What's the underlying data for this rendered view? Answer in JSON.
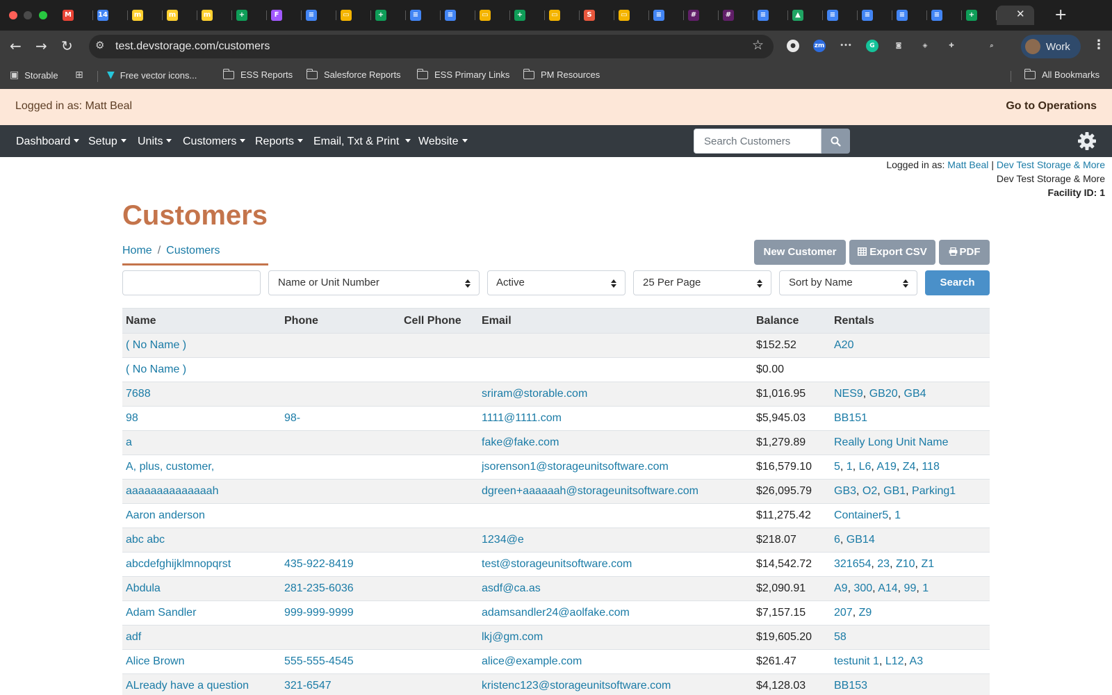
{
  "browser": {
    "tabs": [
      {
        "icon": "gmail-icon",
        "color": "#ea4335",
        "glyph": "M"
      },
      {
        "icon": "calendar-icon",
        "color": "#4285f4",
        "glyph": "14"
      },
      {
        "icon": "miro-icon",
        "color": "#ffd02f",
        "glyph": "m"
      },
      {
        "icon": "miro-icon",
        "color": "#ffd02f",
        "glyph": "m"
      },
      {
        "icon": "miro-icon",
        "color": "#ffd02f",
        "glyph": "m"
      },
      {
        "icon": "sheets-icon",
        "color": "#0f9d58",
        "glyph": "+"
      },
      {
        "icon": "figma-icon",
        "color": "#a259ff",
        "glyph": "F"
      },
      {
        "icon": "docs-icon",
        "color": "#4285f4",
        "glyph": "≡"
      },
      {
        "icon": "slides-icon",
        "color": "#f4b400",
        "glyph": "▭"
      },
      {
        "icon": "sheets-icon",
        "color": "#0f9d58",
        "glyph": "+"
      },
      {
        "icon": "docs-icon",
        "color": "#4285f4",
        "glyph": "≡"
      },
      {
        "icon": "docs-icon",
        "color": "#4285f4",
        "glyph": "≡"
      },
      {
        "icon": "slides-icon",
        "color": "#f4b400",
        "glyph": "▭"
      },
      {
        "icon": "sheets-icon",
        "color": "#0f9d58",
        "glyph": "+"
      },
      {
        "icon": "slides-icon",
        "color": "#f4b400",
        "glyph": "▭"
      },
      {
        "icon": "storable-icon",
        "color": "#e8573d",
        "glyph": "S"
      },
      {
        "icon": "slides-icon",
        "color": "#f4b400",
        "glyph": "▭"
      },
      {
        "icon": "docs-icon",
        "color": "#4285f4",
        "glyph": "≡"
      },
      {
        "icon": "slack-icon",
        "color": "#611f69",
        "glyph": "#"
      },
      {
        "icon": "slack-icon",
        "color": "#611f69",
        "glyph": "#"
      },
      {
        "icon": "docs-icon",
        "color": "#4285f4",
        "glyph": "≡"
      },
      {
        "icon": "drive-icon",
        "color": "#1fa463",
        "glyph": "▲"
      },
      {
        "icon": "docs-icon",
        "color": "#4285f4",
        "glyph": "≡"
      },
      {
        "icon": "docs-icon",
        "color": "#4285f4",
        "glyph": "≡"
      },
      {
        "icon": "docs-icon",
        "color": "#4285f4",
        "glyph": "≡"
      },
      {
        "icon": "docs-icon",
        "color": "#4285f4",
        "glyph": "≡"
      },
      {
        "icon": "sheets-icon",
        "color": "#0f9d58",
        "glyph": "+"
      }
    ],
    "url": "test.devstorage.com/customers",
    "profile_label": "Work",
    "bookmarks": {
      "storable": "Storable",
      "free_vector": "Free vector icons...",
      "ess_reports": "ESS Reports",
      "salesforce_reports": "Salesforce Reports",
      "ess_primary_links": "ESS Primary Links",
      "pm_resources": "PM Resources",
      "all_bookmarks": "All Bookmarks"
    }
  },
  "banner": {
    "logged_in": "Logged in as: Matt Beal",
    "go_to_operations": "Go to Operations"
  },
  "nav": {
    "dashboard": "Dashboard",
    "setup": "Setup",
    "units": "Units",
    "customers": "Customers",
    "reports": "Reports",
    "email_txt_print": "Email, Txt & Print",
    "website": "Website",
    "search_placeholder": "Search Customers"
  },
  "meta": {
    "logged_in_prefix": "Logged in as:",
    "user": "Matt Beal",
    "separator": "|",
    "facility_link": "Dev Test Storage & More",
    "facility_name": "Dev Test Storage & More",
    "facility_id": "Facility ID: 1"
  },
  "page": {
    "title": "Customers",
    "breadcrumb_home": "Home",
    "breadcrumb_sep": "/",
    "breadcrumb_current": "Customers",
    "new_customer": "New Customer",
    "export_csv": "Export CSV",
    "pdf": "PDF"
  },
  "filters": {
    "search_value": "",
    "field": "Name or Unit Number",
    "status": "Active",
    "per_page": "25 Per Page",
    "sort": "Sort by Name",
    "search_button": "Search"
  },
  "table": {
    "headers": [
      "Name",
      "Phone",
      "Cell Phone",
      "Email",
      "Balance",
      "Rentals"
    ],
    "rows": [
      {
        "name": "( No Name )",
        "phone": "",
        "cell": "",
        "email": "",
        "balance": "$152.52",
        "rentals": [
          "A20"
        ]
      },
      {
        "name": "( No Name )",
        "phone": "",
        "cell": "",
        "email": "",
        "balance": "$0.00",
        "rentals": []
      },
      {
        "name": "7688",
        "phone": "",
        "cell": "",
        "email": "sriram@storable.com",
        "balance": "$1,016.95",
        "rentals": [
          "NES9",
          "GB20",
          "GB4"
        ]
      },
      {
        "name": "98",
        "phone": "98-",
        "cell": "",
        "email": "1111@1111.com",
        "balance": "$5,945.03",
        "rentals": [
          "BB151"
        ]
      },
      {
        "name": "a",
        "phone": "",
        "cell": "",
        "email": "fake@fake.com",
        "balance": "$1,279.89",
        "rentals": [
          "Really Long Unit Name"
        ]
      },
      {
        "name": "A, plus, customer,",
        "phone": "",
        "cell": "",
        "email": "jsorenson1@storageunitsoftware.com",
        "balance": "$16,579.10",
        "rentals": [
          "5",
          "1",
          "L6",
          "A19",
          "Z4",
          "118"
        ]
      },
      {
        "name": "aaaaaaaaaaaaaah",
        "phone": "",
        "cell": "",
        "email": "dgreen+aaaaaah@storageunitsoftware.com",
        "balance": "$26,095.79",
        "rentals": [
          "GB3",
          "O2",
          "GB1",
          "Parking1"
        ]
      },
      {
        "name": "Aaron anderson",
        "phone": "",
        "cell": "",
        "email": "",
        "balance": "$11,275.42",
        "rentals": [
          "Container5",
          "1"
        ]
      },
      {
        "name": "abc abc",
        "phone": "",
        "cell": "",
        "email": "1234@e",
        "balance": "$218.07",
        "rentals": [
          "6",
          "GB14"
        ]
      },
      {
        "name": "abcdefghijklmnopqrst",
        "phone": "435-922-8419",
        "cell": "",
        "email": "test@storageunitsoftware.com",
        "balance": "$14,542.72",
        "rentals": [
          "321654",
          "23",
          "Z10",
          "Z1"
        ]
      },
      {
        "name": "Abdula",
        "phone": "281-235-6036",
        "cell": "",
        "email": "asdf@ca.as",
        "balance": "$2,090.91",
        "rentals": [
          "A9",
          "300",
          "A14",
          "99",
          "1"
        ]
      },
      {
        "name": "Adam Sandler",
        "phone": "999-999-9999",
        "cell": "",
        "email": "adamsandler24@aolfake.com",
        "balance": "$7,157.15",
        "rentals": [
          "207",
          "Z9"
        ]
      },
      {
        "name": "adf",
        "phone": "",
        "cell": "",
        "email": "lkj@gm.com",
        "balance": "$19,605.20",
        "rentals": [
          "58"
        ]
      },
      {
        "name": "Alice Brown",
        "phone": "555-555-4545",
        "cell": "",
        "email": "alice@example.com",
        "balance": "$261.47",
        "rentals": [
          "testunit 1",
          "L12",
          "A3"
        ]
      },
      {
        "name": "ALready have a question",
        "phone": "321-6547",
        "cell": "",
        "email": "kristenc123@storageunitsoftware.com",
        "balance": "$4,128.03",
        "rentals": [
          "BB153"
        ]
      }
    ]
  },
  "colors": {
    "accent": "#c4744b",
    "link": "#1a7ba6",
    "navbar": "#343a40",
    "banner": "#fde7d8",
    "secondary_button": "#8b98a7",
    "primary_button": "#4a90c9"
  }
}
